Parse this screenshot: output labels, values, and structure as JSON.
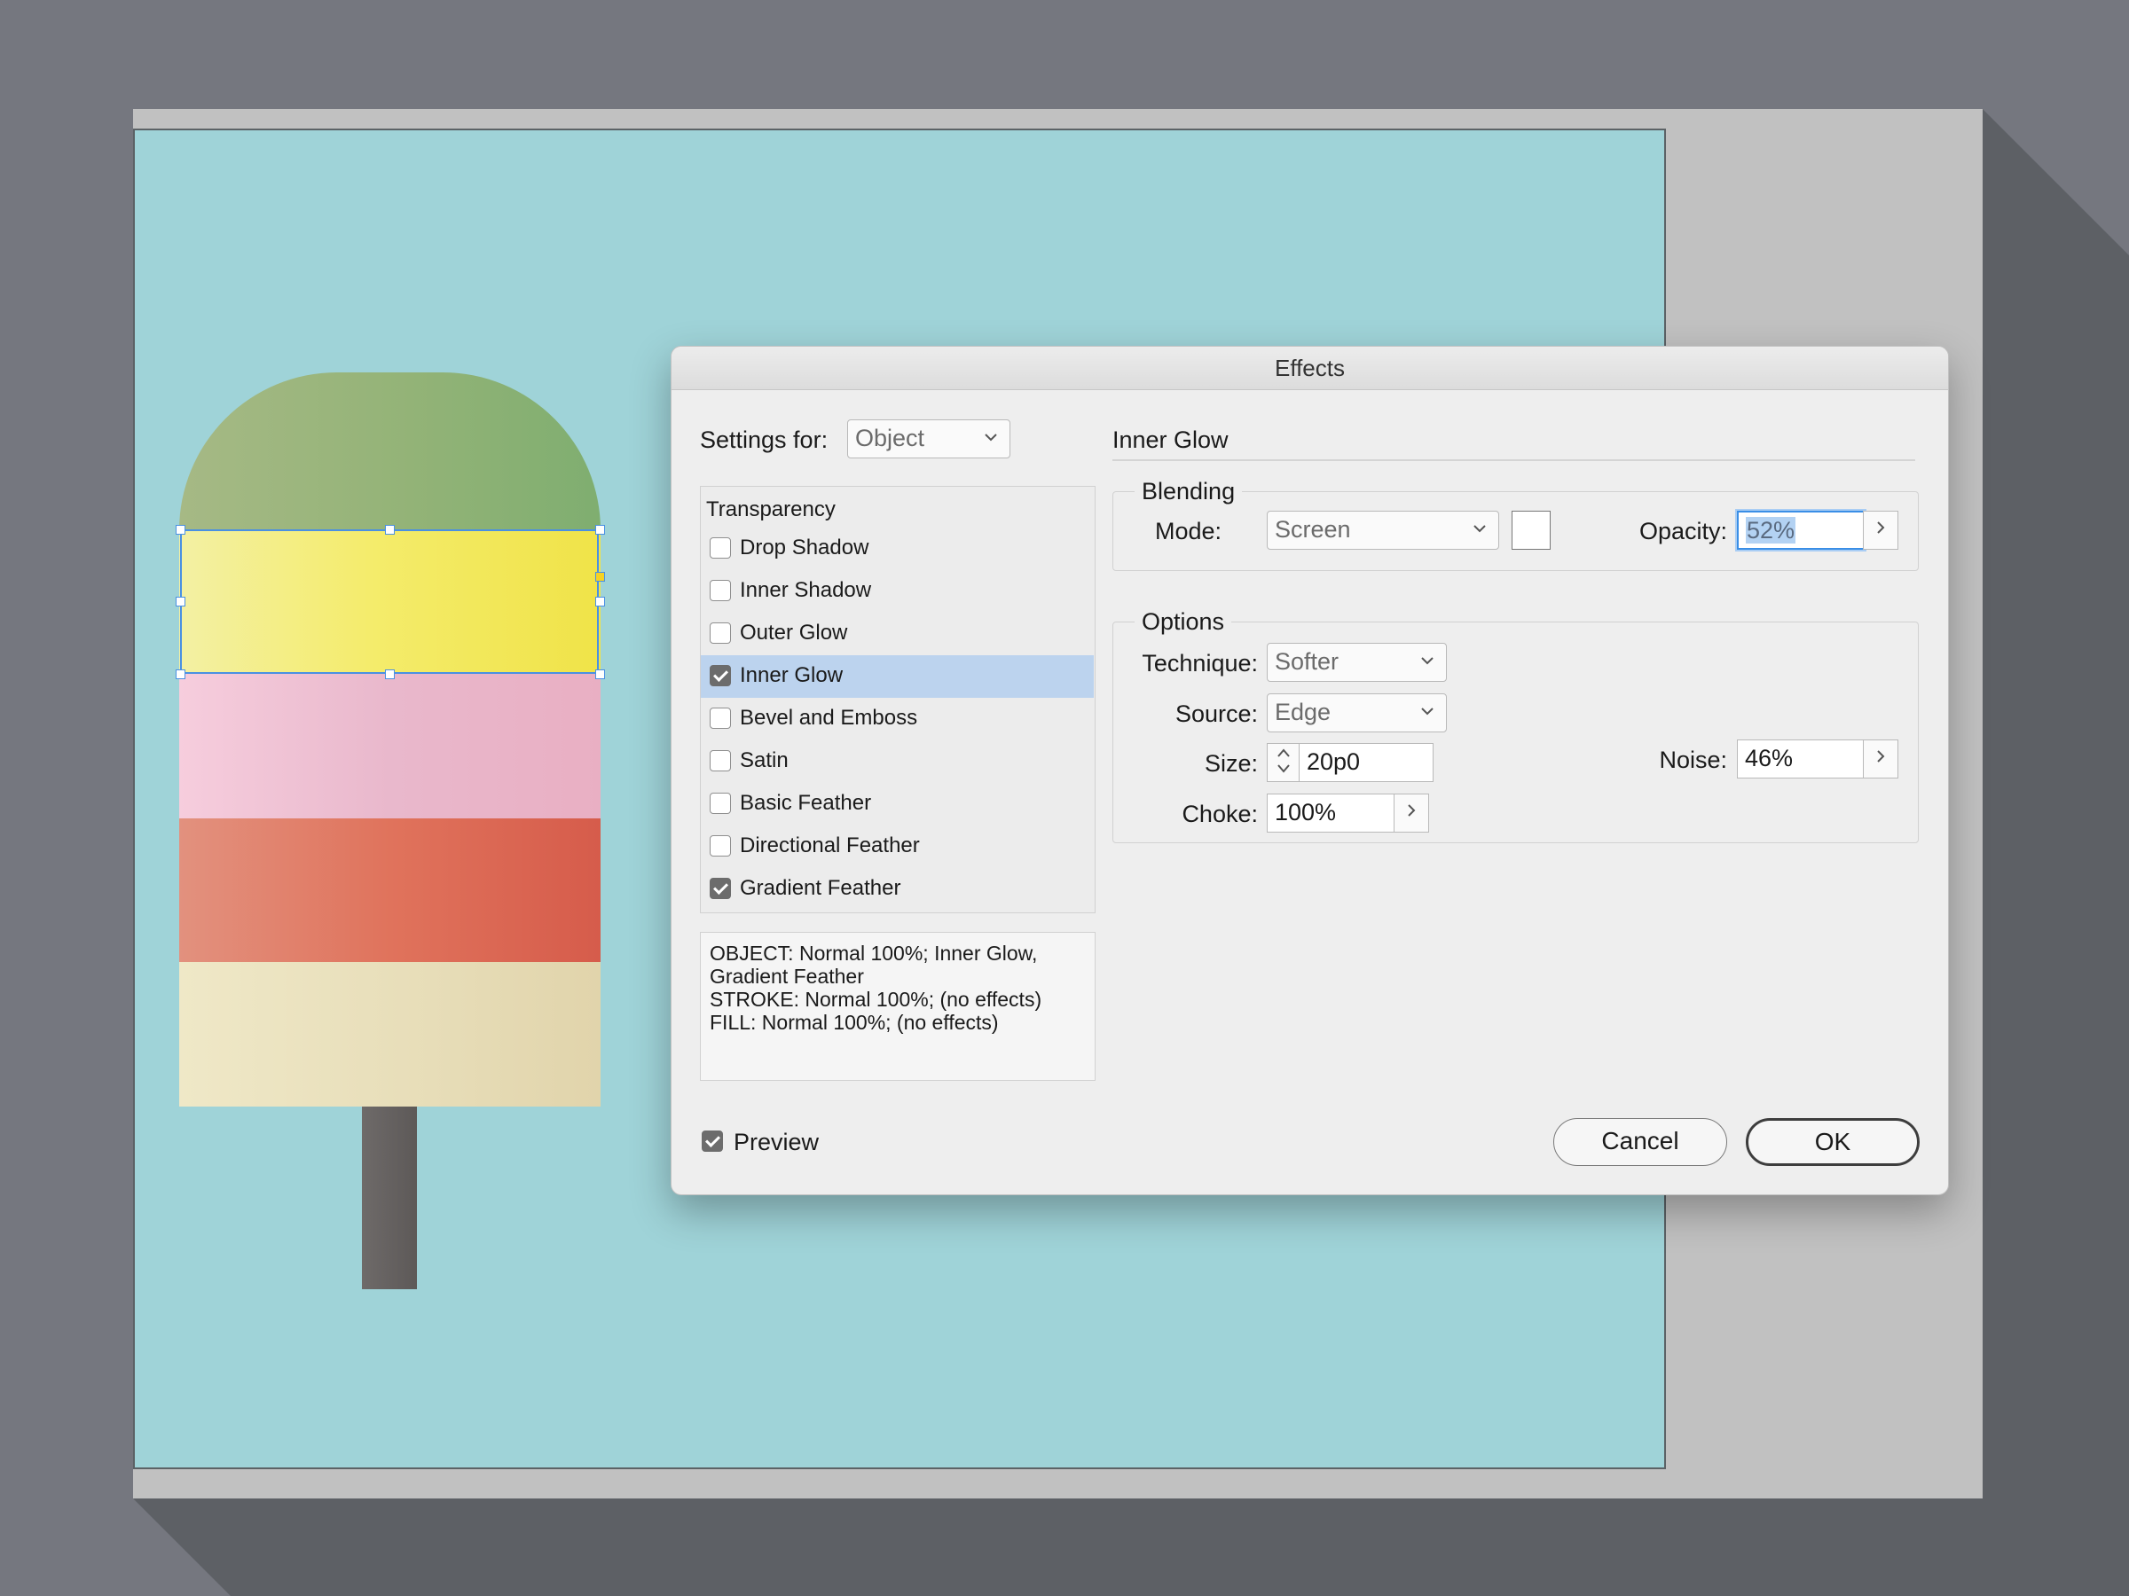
{
  "dialog": {
    "title": "Effects",
    "settings_for": {
      "label": "Settings for:",
      "value": "Object"
    },
    "effects_list": [
      {
        "label": "Transparency",
        "is_header": true
      },
      {
        "label": "Drop Shadow",
        "checked": false
      },
      {
        "label": "Inner Shadow",
        "checked": false
      },
      {
        "label": "Outer Glow",
        "checked": false
      },
      {
        "label": "Inner Glow",
        "checked": true,
        "selected": true
      },
      {
        "label": "Bevel and Emboss",
        "checked": false
      },
      {
        "label": "Satin",
        "checked": false
      },
      {
        "label": "Basic Feather",
        "checked": false
      },
      {
        "label": "Directional Feather",
        "checked": false
      },
      {
        "label": "Gradient Feather",
        "checked": true
      }
    ],
    "summary": [
      "OBJECT: Normal 100%; Inner Glow,",
      "Gradient Feather",
      "STROKE: Normal 100%; (no effects)",
      "FILL: Normal 100%; (no effects)"
    ],
    "preview": {
      "label": "Preview",
      "checked": true
    },
    "panel_title": "Inner Glow",
    "blending": {
      "legend": "Blending",
      "mode_label": "Mode:",
      "mode_value": "Screen",
      "swatch_color": "#ffffff",
      "opacity_label": "Opacity:",
      "opacity_value": "52%"
    },
    "options": {
      "legend": "Options",
      "technique_label": "Technique:",
      "technique_value": "Softer",
      "source_label": "Source:",
      "source_value": "Edge",
      "size_label": "Size:",
      "size_value": "20p0",
      "choke_label": "Choke:",
      "choke_value": "100%",
      "noise_label": "Noise:",
      "noise_value": "46%"
    },
    "buttons": {
      "cancel": "Cancel",
      "ok": "OK"
    }
  },
  "colors": {
    "background": "#75777f",
    "pasteboard": "#c1c1c1",
    "page": "#9fd3d8",
    "selection": "#4a90e2",
    "list_selection": "#bcd3ee"
  }
}
